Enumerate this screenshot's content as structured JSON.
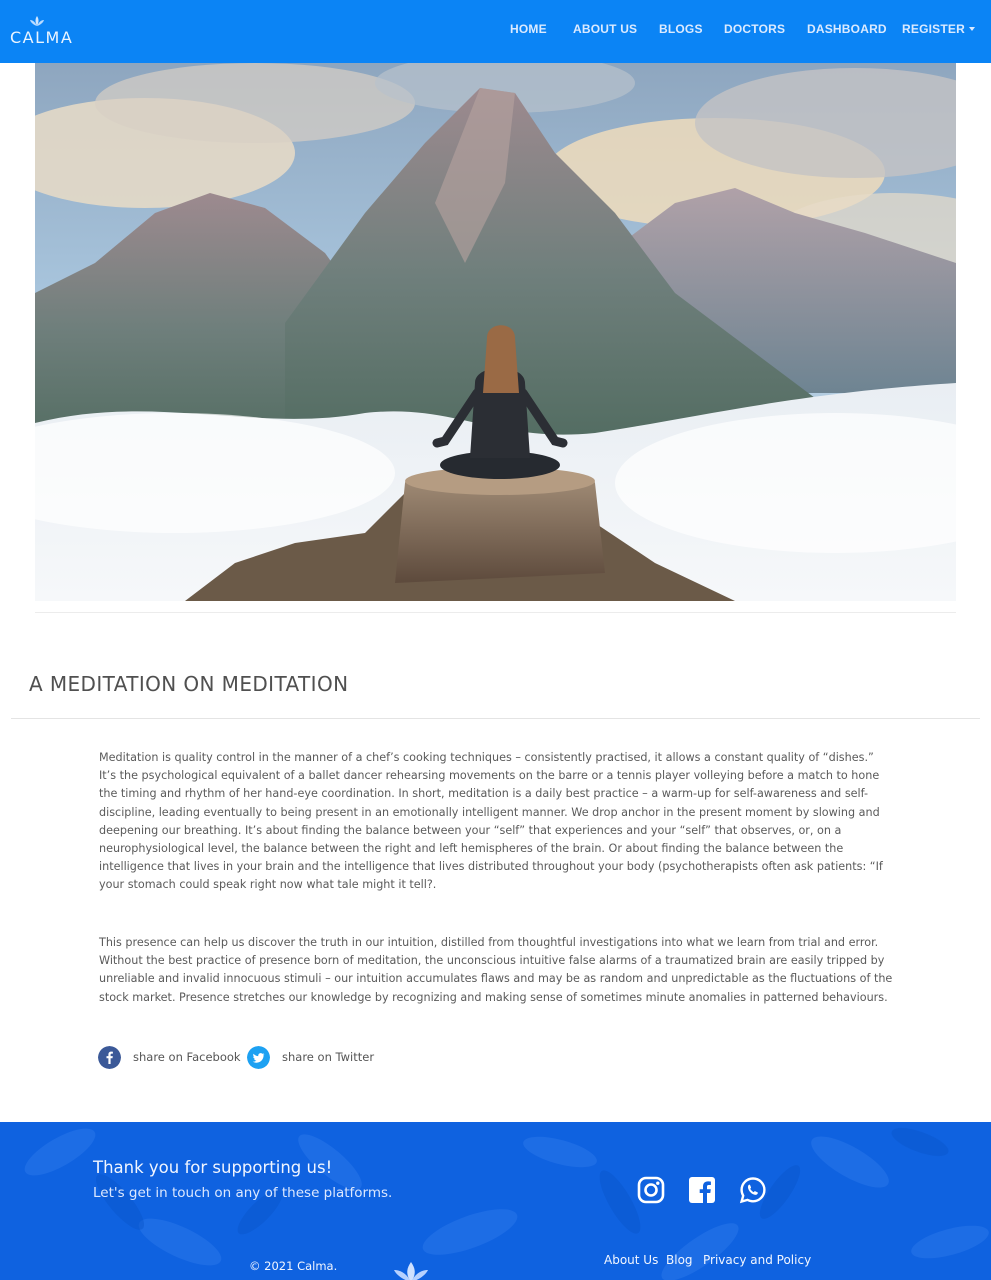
{
  "brand": {
    "name": "CALMA"
  },
  "nav": {
    "items": [
      {
        "label": "HOME"
      },
      {
        "label": "ABOUT US"
      },
      {
        "label": "BLOGS"
      },
      {
        "label": "DOCTORS"
      },
      {
        "label": "DASHBOARD"
      },
      {
        "label": "REGISTER"
      }
    ]
  },
  "article": {
    "title": "A MEDITATION ON MEDITATION",
    "paragraphs": [
      "Meditation is quality control in the manner of a chef’s cooking techniques – consistently practised, it allows a constant quality of “dishes.” It’s the psychological equivalent of a ballet dancer rehearsing movements on the barre or a tennis player volleying before a match to hone the timing and rhythm of her hand-eye coordination. In short, meditation is a daily best practice – a warm-up for self-awareness and self-discipline, leading eventually to being present in an emotionally intelligent manner. We drop anchor in the present moment by slowing and deepening our breathing. It’s about finding the balance between your “self” that experiences and your “self” that observes, or, on a neurophysiological level, the balance between the right and left hemispheres of the brain. Or about finding the balance between the intelligence that lives in your brain and the intelligence that lives distributed throughout your body (psychotherapists often ask patients: “If your stomach could speak right now what tale might it tell?.",
      "This presence can help us discover the truth in our intuition, distilled from thoughtful investigations into what we learn from trial and error. Without the best practice of presence born of meditation, the unconscious intuitive false alarms of a traumatized brain are easily tripped by unreliable and invalid innocuous stimuli – our intuition accumulates flaws and may be as random and unpredictable as the fluctuations of the stock market. Presence stretches our knowledge by recognizing and making sense of sometimes minute anomalies in patterned behaviours."
    ]
  },
  "share": {
    "facebook": "share on Facebook",
    "twitter": "share on Twitter"
  },
  "footer": {
    "thanks": "Thank you for supporting us!",
    "touch": "Let's get in touch on any of these platforms.",
    "copyright": "© 2021 Calma.",
    "links": [
      "About Us",
      "Blog",
      "Privacy and Policy"
    ]
  },
  "colors": {
    "navbar": "#0b84f5",
    "footer": "#0f62e0",
    "facebook": "#3b5998",
    "twitter": "#1da1f2"
  },
  "icons": {
    "social": [
      "instagram-icon",
      "facebook-icon",
      "whatsapp-icon"
    ]
  }
}
